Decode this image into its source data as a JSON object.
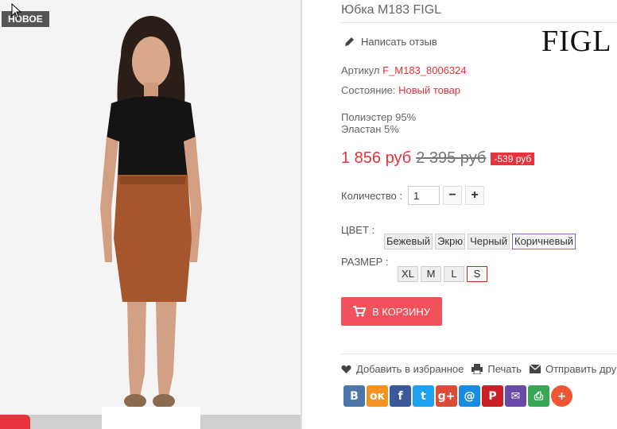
{
  "photo": {
    "badge_new": "НОВОЕ"
  },
  "product": {
    "title": "Юбка M183 FIGL",
    "review_label": "Написать отзыв",
    "brand": "FIGL",
    "sku_label": "Артикул",
    "sku_value": "F_M183_8006324",
    "condition_label": "Состояние:",
    "condition_value": "Новый товар",
    "composition": [
      "Полиэстер 95%",
      "Эластан 5%"
    ],
    "price_new": "1 856 руб",
    "price_old": "2 395 руб",
    "discount": "-539 руб"
  },
  "quantity": {
    "label": "Количество :",
    "value": "1",
    "minus": "−",
    "plus": "+"
  },
  "color": {
    "label": "ЦВЕТ :",
    "options": [
      "Бежевый",
      "Экрю",
      "Черный",
      "Коричневый"
    ],
    "selected": "Коричневый"
  },
  "size": {
    "label": "РАЗМЕР :",
    "options": [
      "XL",
      "M",
      "L",
      "S"
    ],
    "selected": "S"
  },
  "cart_button": "В КОРЗИНУ",
  "actions": {
    "favorite": "Добавить в избранное",
    "print": "Печать",
    "send": "Отправить другу"
  },
  "share": {
    "buttons": [
      {
        "name": "vk",
        "label": "B",
        "color": "#4a76a8"
      },
      {
        "name": "odnoklassniki",
        "label": "ок",
        "color": "#f7931e"
      },
      {
        "name": "facebook",
        "label": "f",
        "color": "#3b5998"
      },
      {
        "name": "twitter",
        "label": "t",
        "color": "#1da1f2"
      },
      {
        "name": "googleplus",
        "label": "g+",
        "color": "#dd4b39"
      },
      {
        "name": "mail",
        "label": "@",
        "color": "#168de2"
      },
      {
        "name": "pinterest",
        "label": "P",
        "color": "#cb2027"
      },
      {
        "name": "email",
        "label": "✉",
        "color": "#6a4aa8"
      },
      {
        "name": "print",
        "label": "⎙",
        "color": "#3aa757"
      },
      {
        "name": "more",
        "label": "+",
        "color": "#ee5533"
      }
    ]
  },
  "colors": {
    "accent": "#e8323c",
    "cart_bg": "#f2505a"
  }
}
